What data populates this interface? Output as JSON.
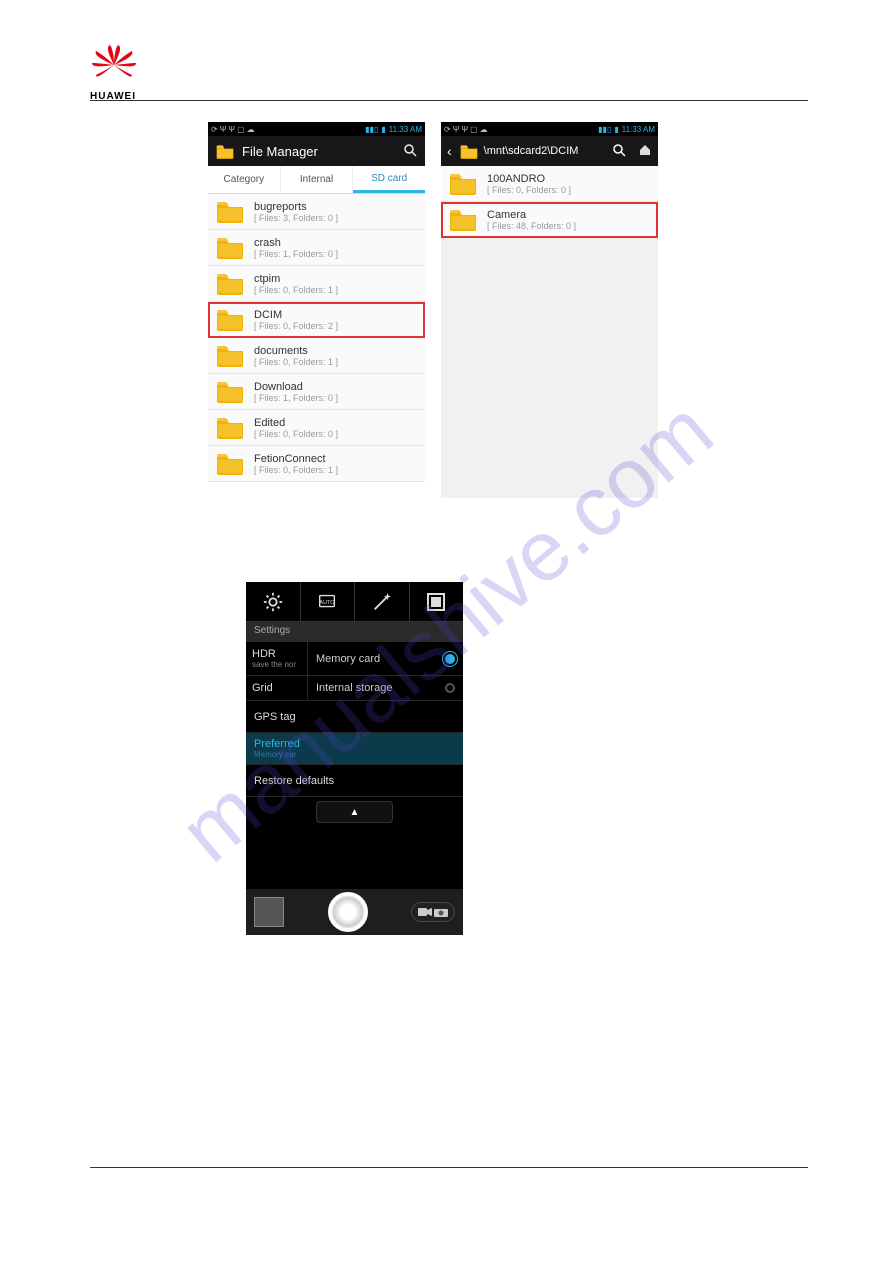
{
  "brand": {
    "name": "HUAWEI"
  },
  "watermark": "manualshive.com",
  "status": {
    "time": "11:33 AM"
  },
  "left_phone": {
    "app_title": "File Manager",
    "tabs": {
      "category": "Category",
      "internal": "Internal",
      "sdcard": "SD card"
    },
    "folders": [
      {
        "name": "bugreports",
        "sub": "[ Files: 3, Folders: 0 ]",
        "hl": false
      },
      {
        "name": "crash",
        "sub": "[ Files: 1, Folders: 0 ]",
        "hl": false
      },
      {
        "name": "ctpim",
        "sub": "[ Files: 0, Folders: 1 ]",
        "hl": false
      },
      {
        "name": "DCIM",
        "sub": "[ Files: 0, Folders: 2 ]",
        "hl": true
      },
      {
        "name": "documents",
        "sub": "[ Files: 0, Folders: 1 ]",
        "hl": false
      },
      {
        "name": "Download",
        "sub": "[ Files: 1, Folders: 0 ]",
        "hl": false
      },
      {
        "name": "Edited",
        "sub": "[ Files: 0, Folders: 0 ]",
        "hl": false
      },
      {
        "name": "FetionConnect",
        "sub": "[ Files: 0, Folders: 1 ]",
        "hl": false
      }
    ]
  },
  "right_phone": {
    "path": "\\mnt\\sdcard2\\DCIM",
    "folders": [
      {
        "name": "100ANDRO",
        "sub": "[ Files: 0, Folders: 0 ]",
        "hl": false
      },
      {
        "name": "Camera",
        "sub": "[ Files: 48, Folders: 0 ]",
        "hl": true
      }
    ]
  },
  "camera": {
    "settings_label": "Settings",
    "hdr": "HDR",
    "hdr_sub": "save the nor",
    "memory_card": "Memory card",
    "internal_storage": "Internal storage",
    "grid": "Grid",
    "gps": "GPS tag",
    "preferred": "Preferred",
    "preferred_sub": "Memory car",
    "restore": "Restore defaults"
  }
}
